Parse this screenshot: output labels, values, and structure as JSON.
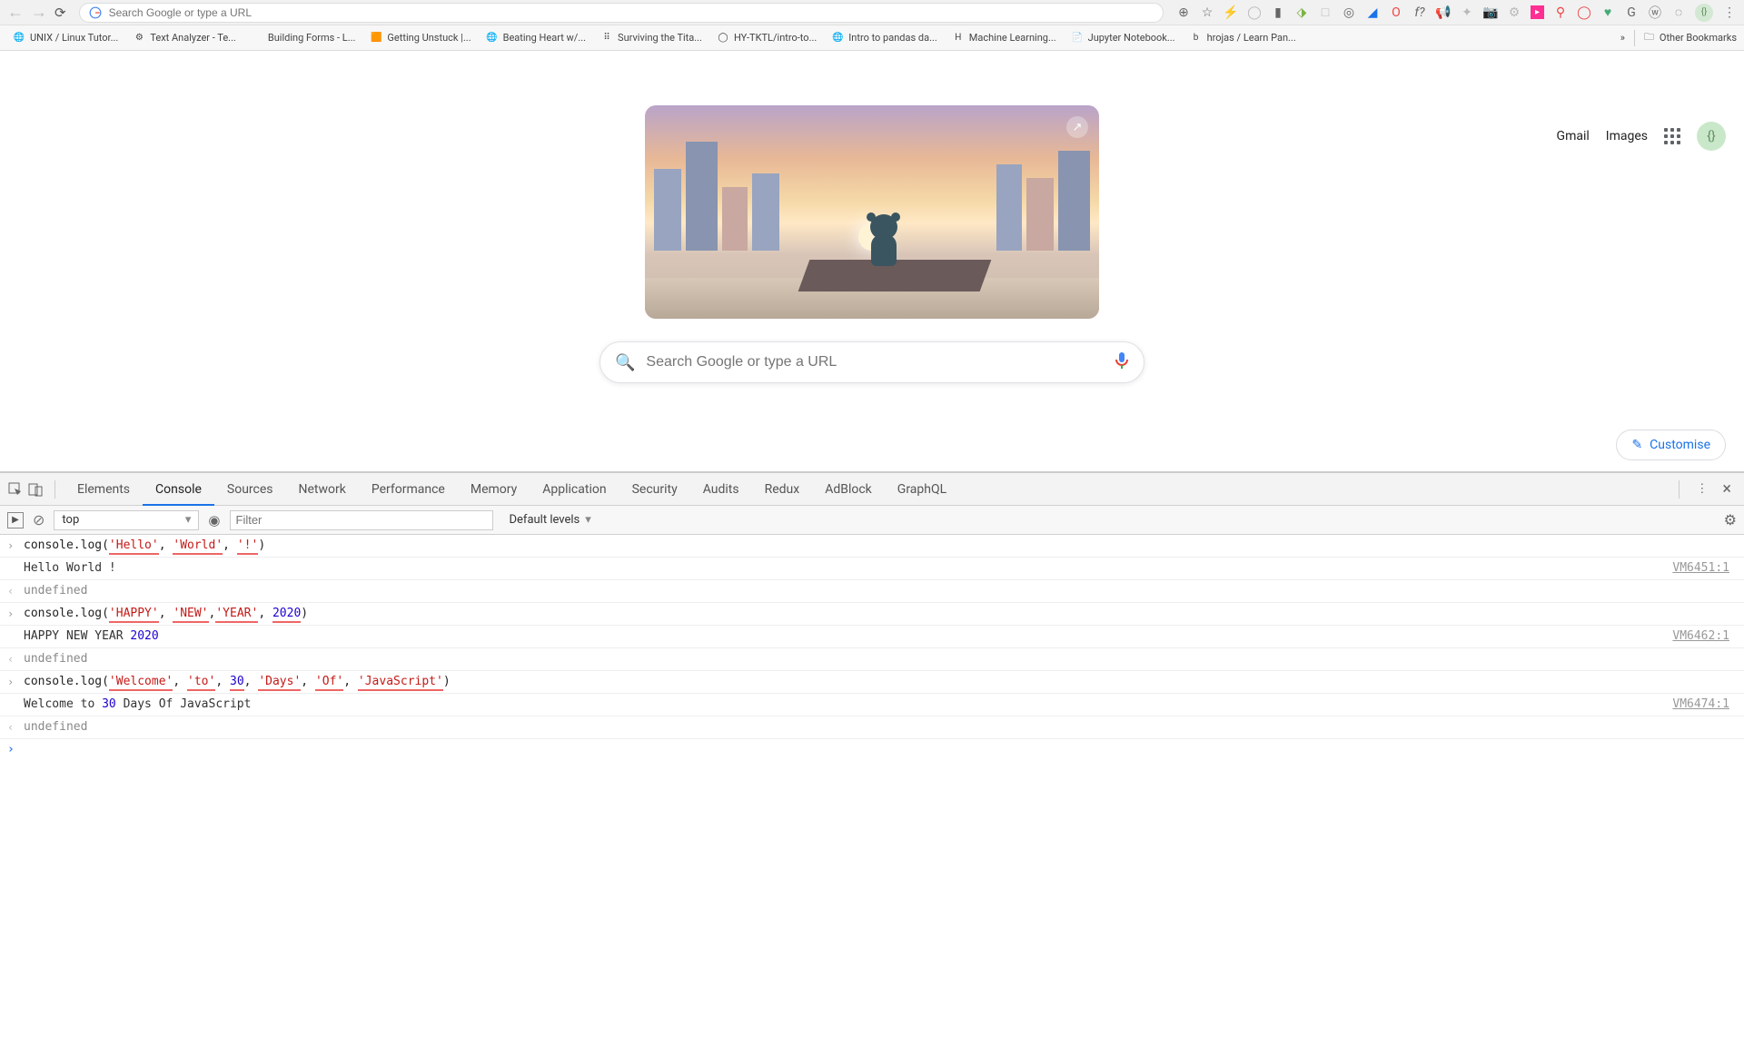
{
  "browser": {
    "omnibox_placeholder": "Search Google or type a URL",
    "bookmarks": [
      {
        "label": "UNIX / Linux Tutor...",
        "icon": "globe"
      },
      {
        "label": "Text Analyzer - Te...",
        "icon": "gear"
      },
      {
        "label": "Building Forms - L...",
        "icon": "code"
      },
      {
        "label": "Getting Unstuck |...",
        "icon": "square-orange"
      },
      {
        "label": "Beating Heart w/...",
        "icon": "globe"
      },
      {
        "label": "Surviving the Tita...",
        "icon": "dots"
      },
      {
        "label": "HY-TKTL/intro-to...",
        "icon": "github"
      },
      {
        "label": "Intro to pandas da...",
        "icon": "globe"
      },
      {
        "label": "Machine Learning...",
        "icon": "h-blue"
      },
      {
        "label": "Jupyter Notebook...",
        "icon": "doc"
      },
      {
        "label": "hrojas / Learn Pan...",
        "icon": "b-blue"
      }
    ],
    "other_bookmarks": "Other Bookmarks"
  },
  "google": {
    "gmail": "Gmail",
    "images": "Images",
    "search_placeholder": "Search Google or type a URL",
    "customise": "Customise"
  },
  "devtools": {
    "tabs": [
      "Elements",
      "Console",
      "Sources",
      "Network",
      "Performance",
      "Memory",
      "Application",
      "Security",
      "Audits",
      "Redux",
      "AdBlock",
      "GraphQL"
    ],
    "active_tab": "Console",
    "context": "top",
    "filter_placeholder": "Filter",
    "levels": "Default levels",
    "console": [
      {
        "type": "input",
        "segments": [
          {
            "t": "fn",
            "v": "console.log("
          },
          {
            "t": "str",
            "v": "'Hello'"
          },
          {
            "t": "fn",
            "v": ", "
          },
          {
            "t": "str",
            "v": "'World'"
          },
          {
            "t": "fn",
            "v": ", "
          },
          {
            "t": "str",
            "v": "'!'"
          },
          {
            "t": "fn",
            "v": ")"
          }
        ]
      },
      {
        "type": "log",
        "text": "Hello World !",
        "src": "VM6451:1"
      },
      {
        "type": "result",
        "text": "undefined"
      },
      {
        "type": "input",
        "segments": [
          {
            "t": "fn",
            "v": "console.log("
          },
          {
            "t": "str",
            "v": "'HAPPY'"
          },
          {
            "t": "fn",
            "v": ", "
          },
          {
            "t": "str",
            "v": "'NEW'"
          },
          {
            "t": "fn",
            "v": ","
          },
          {
            "t": "str",
            "v": "'YEAR'"
          },
          {
            "t": "fn",
            "v": ", "
          },
          {
            "t": "num",
            "v": "2020"
          },
          {
            "t": "fn",
            "v": ")"
          }
        ]
      },
      {
        "type": "log",
        "segments": [
          {
            "t": "plain",
            "v": "HAPPY NEW YEAR "
          },
          {
            "t": "numout",
            "v": "2020"
          }
        ],
        "src": "VM6462:1"
      },
      {
        "type": "result",
        "text": "undefined"
      },
      {
        "type": "input",
        "segments": [
          {
            "t": "fn",
            "v": "console.log("
          },
          {
            "t": "str",
            "v": "'Welcome'"
          },
          {
            "t": "fn",
            "v": ", "
          },
          {
            "t": "str",
            "v": "'to'"
          },
          {
            "t": "fn",
            "v": ", "
          },
          {
            "t": "num",
            "v": "30"
          },
          {
            "t": "fn",
            "v": ", "
          },
          {
            "t": "str",
            "v": "'Days'"
          },
          {
            "t": "fn",
            "v": ", "
          },
          {
            "t": "str",
            "v": "'Of'"
          },
          {
            "t": "fn",
            "v": ", "
          },
          {
            "t": "str",
            "v": "'JavaScript'"
          },
          {
            "t": "fn",
            "v": ")"
          }
        ]
      },
      {
        "type": "log",
        "segments": [
          {
            "t": "plain",
            "v": "Welcome to "
          },
          {
            "t": "numout",
            "v": "30"
          },
          {
            "t": "plain",
            "v": " Days Of JavaScript"
          }
        ],
        "src": "VM6474:1"
      },
      {
        "type": "result",
        "text": "undefined"
      }
    ]
  }
}
